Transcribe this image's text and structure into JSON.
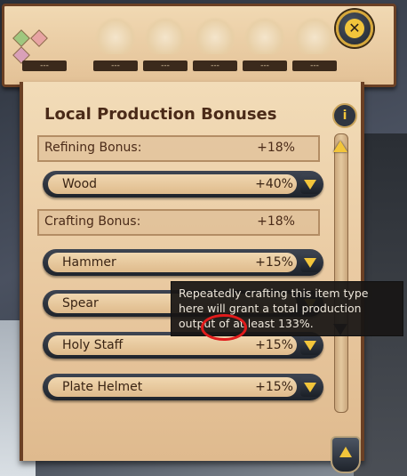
{
  "resource_bar": {
    "resources": [
      {
        "icon": "gems-icon",
        "amount": "---"
      },
      {
        "icon": "logs-icon",
        "amount": "---"
      },
      {
        "icon": "ore-icon",
        "amount": "---"
      },
      {
        "icon": "hide-icon",
        "amount": "---"
      },
      {
        "icon": "fiber-icon",
        "amount": "---"
      },
      {
        "icon": "stone-icon",
        "amount": "---"
      }
    ],
    "gem_colors": [
      "#9fc77f",
      "#e7a3a3",
      "#d9a0b8"
    ]
  },
  "panel": {
    "title": "Local Production Bonuses",
    "info_label": "i",
    "refining": {
      "label": "Refining Bonus:",
      "value": "+18%"
    },
    "refining_items": [
      {
        "name": "Wood",
        "value": "+40%"
      }
    ],
    "crafting": {
      "label": "Crafting Bonus:",
      "value": "+18%"
    },
    "crafting_items": [
      {
        "name": "Hammer",
        "value": "+15%"
      },
      {
        "name": "Spear",
        "value": ""
      },
      {
        "name": "Holy Staff",
        "value": "+15%"
      },
      {
        "name": "Plate Helmet",
        "value": "+15%"
      }
    ]
  },
  "tooltip": {
    "text": "Repeatedly crafting this item type here will grant a total production output of at least 133%."
  },
  "colors": {
    "accent_gold": "#f2c53b",
    "parchment": "#e8c79e",
    "frame_brown": "#6b4024",
    "highlight_red": "#e01b1b"
  }
}
